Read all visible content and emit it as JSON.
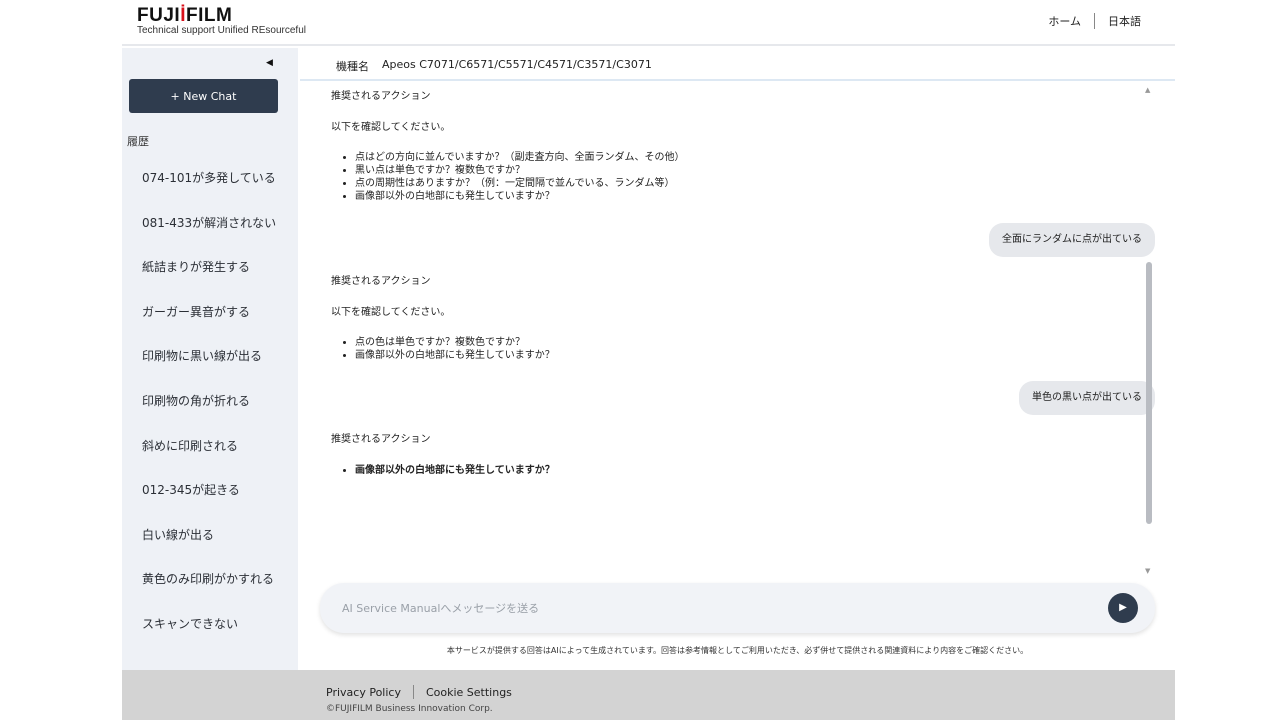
{
  "header": {
    "logo_prefix": "FUJI",
    "logo_mark": "İ",
    "logo_suffix": "FILM",
    "tagline": "Technical support Unified REsourceful",
    "nav": {
      "home": "ホーム",
      "language": "日本語"
    }
  },
  "sidebar": {
    "collapse_icon": "◀",
    "new_chat_label": "+ New Chat",
    "history_label": "履歴",
    "history": [
      "074-101が多発している",
      "081-433が解消されない",
      "紙詰まりが発生する",
      "ガーガー異音がする",
      "印刷物に黒い線が出る",
      "印刷物の角が折れる",
      "斜めに印刷される",
      "012-345が起きる",
      "白い線が出る",
      "黄色のみ印刷がかすれる",
      "スキャンできない"
    ]
  },
  "model_bar": {
    "label": "機種名",
    "value": "Apeos C7071/C6571/C5571/C4571/C3571/C3071"
  },
  "chat": {
    "messages": [
      {
        "role": "assistant",
        "title": "推奨されるアクション",
        "intro": "以下を確認してください。",
        "items": [
          "点はどの方向に並んでいますか？（副走査方向、全面ランダム、その他）",
          "黒い点は単色ですか？複数色ですか？",
          "点の周期性はありますか？（例：一定間隔で並んでいる、ランダム等）",
          "画像部以外の白地部にも発生していますか？"
        ]
      },
      {
        "role": "user",
        "text": "全面にランダムに点が出ている"
      },
      {
        "role": "assistant",
        "title": "推奨されるアクション",
        "intro": "以下を確認してください。",
        "items": [
          "点の色は単色ですか？複数色ですか？",
          "画像部以外の白地部にも発生していますか？"
        ]
      },
      {
        "role": "user",
        "text": "単色の黒い点が出ている"
      },
      {
        "role": "assistant",
        "title": "推奨されるアクション",
        "items": [
          "画像部以外の白地部にも発生していますか？"
        ]
      }
    ]
  },
  "scrollbar": {
    "up_icon": "▲",
    "down_icon": "▼"
  },
  "composer": {
    "placeholder": "AI Service Manualへメッセージを送る",
    "send_icon": "▶"
  },
  "disclaimer": "本サービスが提供する回答はAIによって生成されています。回答は参考情報としてご利用いただき、必ず併せて提供される関連資料により内容をご確認ください。",
  "footer": {
    "privacy": "Privacy Policy",
    "cookie": "Cookie Settings",
    "copyright": "©FUJIFILM Business Innovation Corp."
  },
  "colors": {
    "brand_red": "#d8101a",
    "dark_button": "#2f3c4e",
    "sidebar_bg": "#eef1f6",
    "footer_bg": "#d3d3d3"
  }
}
